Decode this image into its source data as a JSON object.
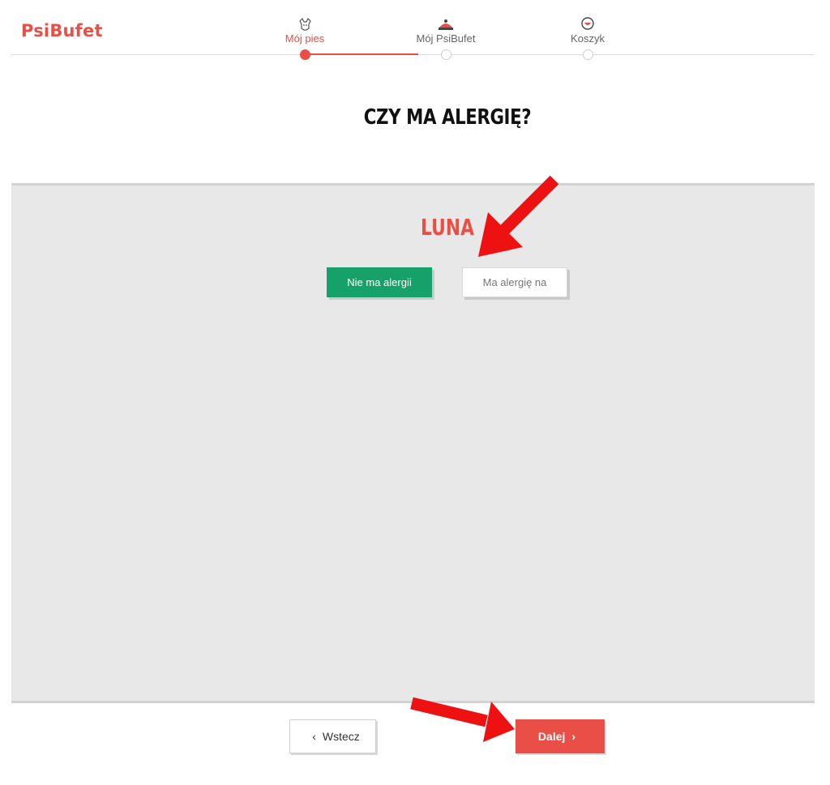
{
  "brand": {
    "name": "PsiBufet"
  },
  "steps": [
    {
      "label": "Mój pies",
      "icon": "dog-icon",
      "active": true
    },
    {
      "label": "Mój PsiBufet",
      "icon": "food-bowl-icon",
      "active": false
    },
    {
      "label": "Koszyk",
      "icon": "basket-icon",
      "active": false
    }
  ],
  "question": {
    "title": "CZY MA ALERGIĘ?"
  },
  "dog": {
    "name": "LUNA"
  },
  "options": {
    "no_allergy": "Nie ma alergii",
    "has_allergy": "Ma alergię na"
  },
  "navigation": {
    "back": "Wstecz",
    "next": "Dalej"
  },
  "colors": {
    "brand": "#ea4f47",
    "selected": "#16a06a",
    "panel": "#e8e8e8"
  }
}
